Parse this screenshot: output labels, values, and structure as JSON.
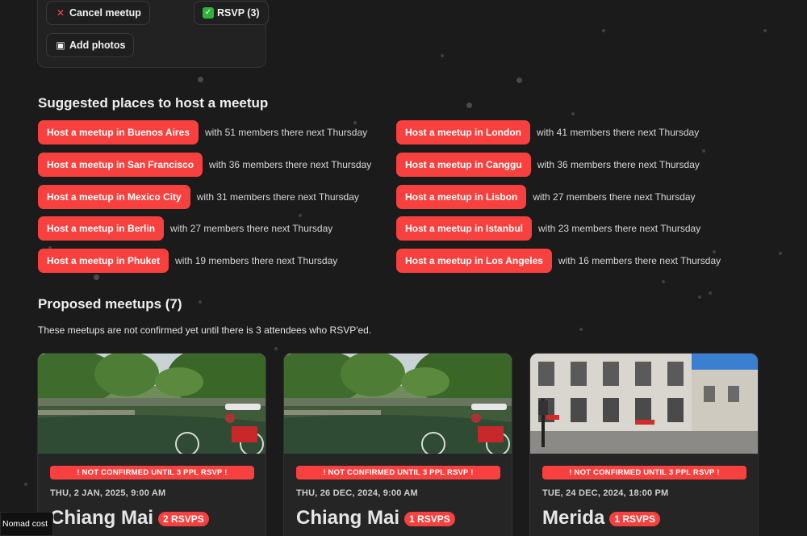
{
  "top_card": {
    "cancel_label": "Cancel meetup",
    "rsvp_label": "RSVP (3)",
    "photos_label": "Add photos"
  },
  "suggested": {
    "title": "Suggested places to host a meetup",
    "left": [
      {
        "button": "Host a meetup in Buenos Aires",
        "note": "with 51 members there next Thursday"
      },
      {
        "button": "Host a meetup in San Francisco",
        "note": "with 36 members there next Thursday"
      },
      {
        "button": "Host a meetup in Mexico City",
        "note": "with 31 members there next Thursday"
      },
      {
        "button": "Host a meetup in Berlin",
        "note": "with 27 members there next Thursday"
      },
      {
        "button": "Host a meetup in Phuket",
        "note": "with 19 members there next Thursday"
      }
    ],
    "right": [
      {
        "button": "Host a meetup in London",
        "note": "with 41 members there next Thursday"
      },
      {
        "button": "Host a meetup in Canggu",
        "note": "with 36 members there next Thursday"
      },
      {
        "button": "Host a meetup in Lisbon",
        "note": "with 27 members there next Thursday"
      },
      {
        "button": "Host a meetup in Istanbul",
        "note": "with 23 members there next Thursday"
      },
      {
        "button": "Host a meetup in Los Angeles",
        "note": "with 16 members there next Thursday"
      }
    ]
  },
  "proposed": {
    "title": "Proposed meetups (7)",
    "note": "These meetups are not confirmed yet until there is 3 attendees who RSVP'ed.",
    "cards": [
      {
        "warning": "! NOT CONFIRMED UNTIL 3 PPL RSVP !",
        "date": "THU, 2 JAN, 2025, 9:00 AM",
        "city": "Chiang Mai",
        "rsvps": "2 RSVPS"
      },
      {
        "warning": "! NOT CONFIRMED UNTIL 3 PPL RSVP !",
        "date": "THU, 26 DEC, 2024, 9:00 AM",
        "city": "Chiang Mai",
        "rsvps": "1 RSVPS"
      },
      {
        "warning": "! NOT CONFIRMED UNTIL 3 PPL RSVP !",
        "date": "TUE, 24 DEC, 2024, 18:00 PM",
        "city": "Merida",
        "rsvps": "1 RSVPS"
      }
    ]
  },
  "footer_tab": "Nomad cost",
  "colors": {
    "accent": "#f8413f",
    "background": "#1b1b1b",
    "card": "#252525"
  }
}
